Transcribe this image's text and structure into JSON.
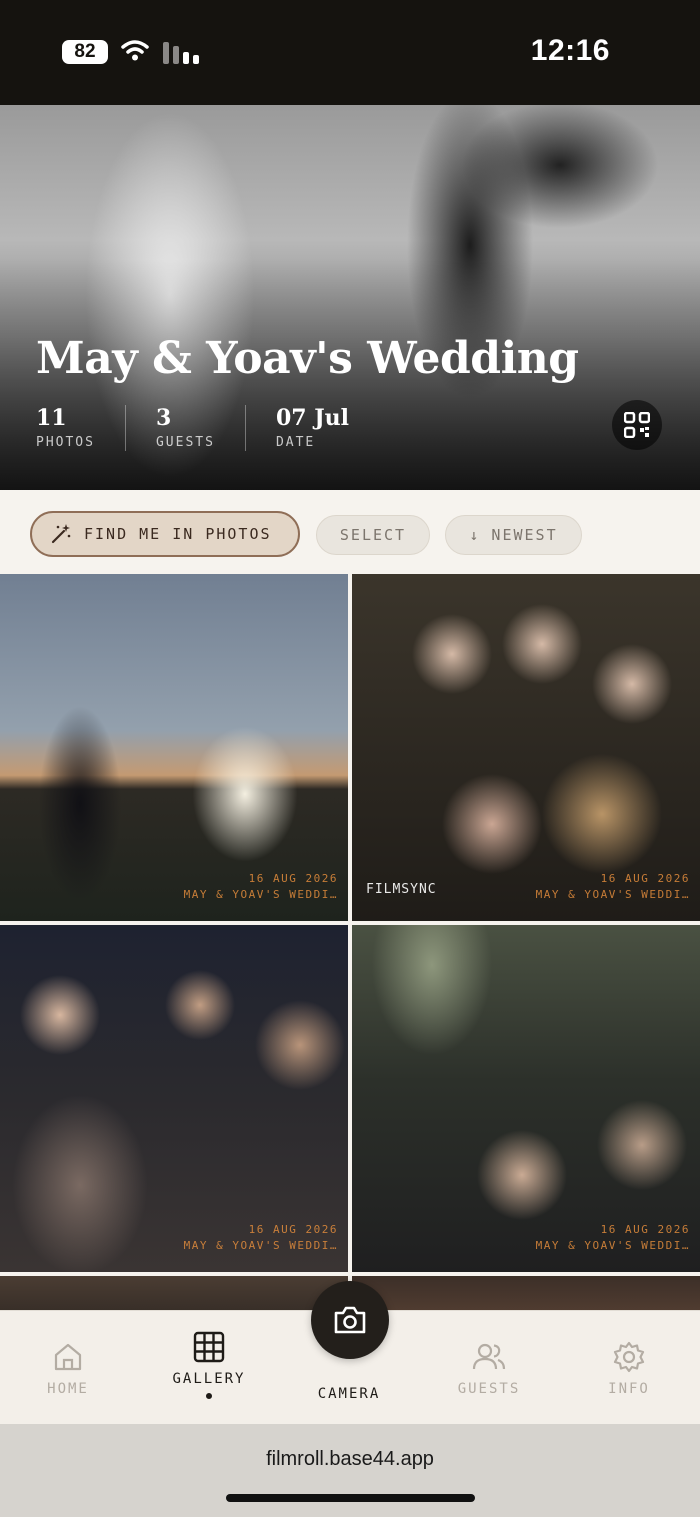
{
  "status_bar": {
    "battery": "82",
    "time": "12:16"
  },
  "hero": {
    "title": "May & Yoav's Wedding",
    "stats": [
      {
        "value": "11",
        "label": "PHOTOS"
      },
      {
        "value": "3",
        "label": "GUESTS"
      },
      {
        "value": "07 Jul",
        "label": "DATE"
      }
    ],
    "qr_icon": "qr-code-icon"
  },
  "toolbar": {
    "find_me": "FIND ME IN PHOTOS",
    "select": "SELECT",
    "newest": "↓ NEWEST"
  },
  "photos": [
    {
      "stamp_date": "16 AUG 2026",
      "stamp_event": "MAY & YOAV'S WEDDI…",
      "brand": ""
    },
    {
      "stamp_date": "16 AUG 2026",
      "stamp_event": "MAY & YOAV'S WEDDI…",
      "brand": "FILMSYNC"
    },
    {
      "stamp_date": "16 AUG 2026",
      "stamp_event": "MAY & YOAV'S WEDDI…",
      "brand": ""
    },
    {
      "stamp_date": "16 AUG 2026",
      "stamp_event": "MAY & YOAV'S WEDDI…",
      "brand": ""
    }
  ],
  "nav": {
    "home": "HOME",
    "gallery": "GALLERY",
    "camera": "CAMERA",
    "guests": "GUESTS",
    "info": "INFO",
    "active": "gallery"
  },
  "browser": {
    "url": "filmroll.base44.app"
  },
  "colors": {
    "accent": "#8f6e57",
    "accent_fill": "#e3d6c7",
    "dark": "#231f1b",
    "muted": "#b3aca3"
  }
}
